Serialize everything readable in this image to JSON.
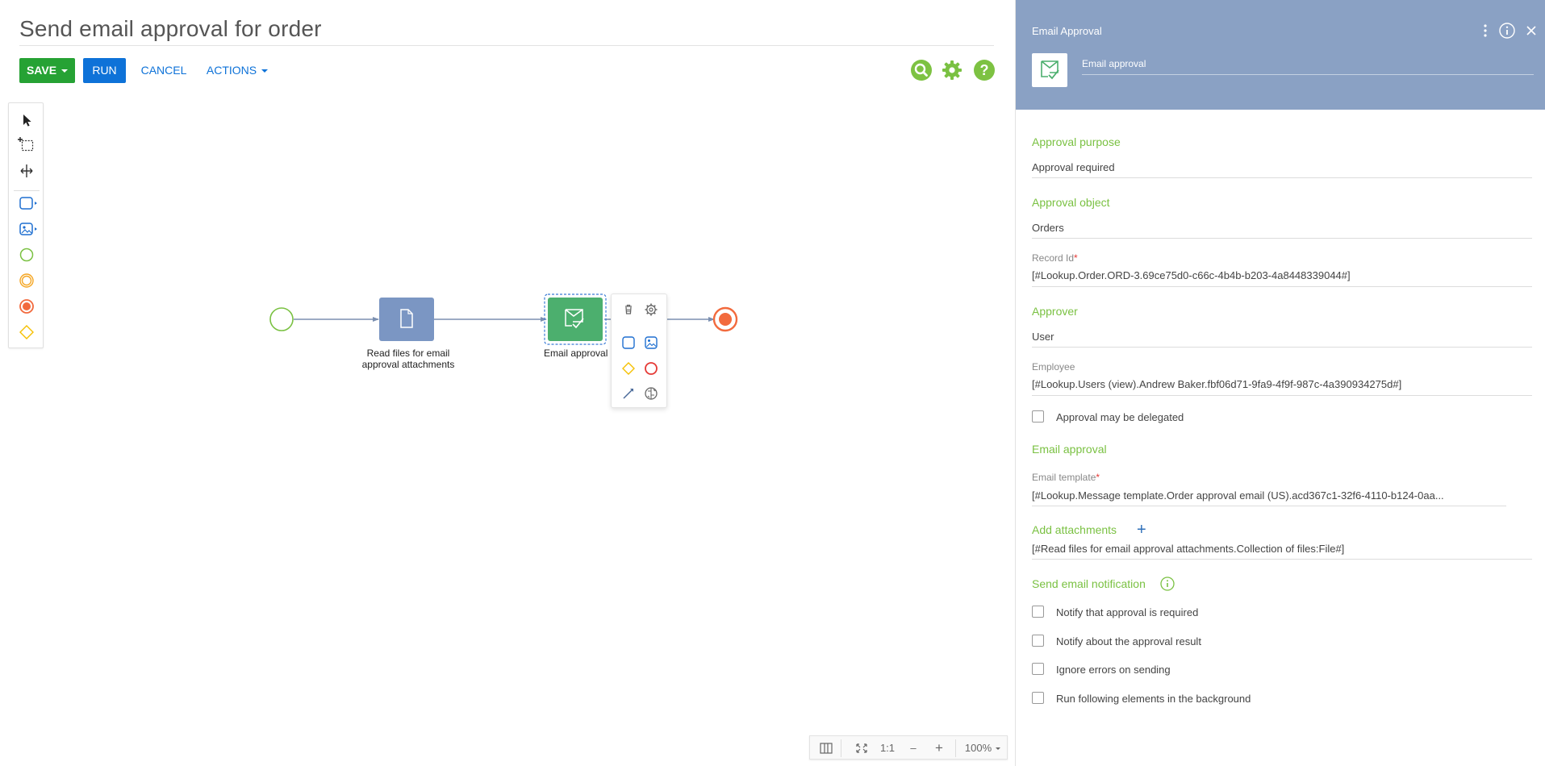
{
  "header": {
    "title": "Send email approval for order",
    "save_label": "SAVE",
    "run_label": "RUN",
    "cancel_label": "CANCEL",
    "actions_label": "ACTIONS"
  },
  "toolbox": {
    "tools": [
      "pointer-icon",
      "lasso-select-icon",
      "space-tool-icon",
      "task-icon",
      "subprocess-icon",
      "start-event-icon",
      "intermediate-event-icon",
      "end-event-icon",
      "gateway-icon"
    ]
  },
  "canvas": {
    "nodes": [
      {
        "type": "start-event",
        "label": ""
      },
      {
        "type": "task",
        "label_line1": "Read files for email",
        "label_line2": "approval attachments"
      },
      {
        "type": "email-approval-task",
        "label": "Email approval"
      },
      {
        "type": "end-event",
        "label": ""
      }
    ]
  },
  "context_menu": {
    "items": [
      "delete-icon",
      "settings-icon",
      "task-icon",
      "subprocess-icon",
      "gateway-icon",
      "end-event-icon",
      "connector-icon",
      "change-type-icon"
    ]
  },
  "zoom_bar": {
    "reset_label": "1:1",
    "minus_label": "–",
    "plus_label": "+",
    "zoom_level": "100%"
  },
  "panel": {
    "title": "Email Approval",
    "element_name": "Email approval",
    "approval_purpose": {
      "section": "Approval purpose",
      "value": "Approval required"
    },
    "approval_object": {
      "section": "Approval object",
      "value": "Orders",
      "record_id_label": "Record Id",
      "record_id_value": "[#Lookup.Order.ORD-3.69ce75d0-c66c-4b4b-b203-4a8448339044#]"
    },
    "approver": {
      "section": "Approver",
      "value": "User",
      "employee_label": "Employee",
      "employee_value": "[#Lookup.Users (view).Andrew Baker.fbf06d71-9fa9-4f9f-987c-4a390934275d#]",
      "delegate_label": "Approval may be delegated"
    },
    "email_approval": {
      "section": "Email approval",
      "template_label": "Email template",
      "template_value": "[#Lookup.Message template.Order approval email (US).acd367c1-32f6-4110-b124-0aa...",
      "attachments_label": "Add attachments",
      "attachments_value": "[#Read files for email approval attachments.Collection of files:File#]"
    },
    "notification": {
      "section": "Send email notification",
      "options": [
        "Notify that approval is required",
        "Notify about the approval result",
        "Ignore errors on sending",
        "Run following elements in the background"
      ]
    }
  },
  "colors": {
    "accent_green": "#7ac142",
    "save_green": "#26a234",
    "run_blue": "#0e72d8",
    "panel_header": "#8aa1c4",
    "task_blue": "#7b96c3",
    "approval_green": "#4caf6e",
    "end_orange": "#f26a3d"
  }
}
